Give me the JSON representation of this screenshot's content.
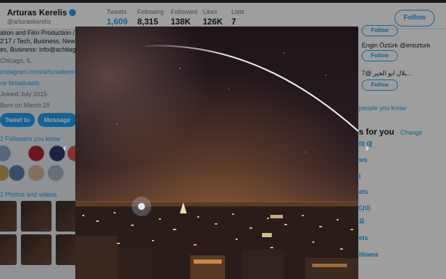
{
  "profile": {
    "name": "Arturas Kerelis",
    "handle": "@arturaskerelis",
    "bio_lines": [
      "ation and Film Production / @OIS",
      "2'17 / Tech, Business, News, Spa",
      "es, Business: info@achitago.org"
    ],
    "location": "Chicago, IL",
    "website": "instagram.com/arturaskerelis",
    "live_link": "ne broadcasts",
    "joined": "Joined July 2015",
    "born": "Born on March 29"
  },
  "stats": [
    {
      "label": "Tweets",
      "value": "1,609"
    },
    {
      "label": "Following",
      "value": "8,315"
    },
    {
      "label": "Followers",
      "value": "138K"
    },
    {
      "label": "Likes",
      "value": "126K"
    },
    {
      "label": "Lists",
      "value": "7"
    }
  ],
  "buttons": {
    "follow": "Follow",
    "tweet_to": "Tweet to",
    "message": "Message"
  },
  "followers_you_know": "2 Followers you know",
  "photos_videos": "2 Photos and videos",
  "who_to_follow": [
    {
      "name": "Engin Öztürk",
      "handle": "@enozturk",
      "follow": "Follow"
    },
    {
      "name": "بلال ابو الخير",
      "handle": "@7...",
      "follow": "Follow"
    }
  ],
  "people_you_know": "people you know",
  "trends": {
    "heading": "s for you",
    "change": "· Change",
    "items": [
      "마 대",
      "ws",
      "I",
      "ets",
      "다이",
      "요",
      "ets",
      "illiams"
    ]
  },
  "colors": {
    "accent": "#1da1f2",
    "night_sky": "#2b1e24",
    "city_glow": "#d98a3a"
  },
  "icons": {
    "verified": "verified-badge-icon",
    "prev": "chevron-left-icon",
    "next": "chevron-right-icon"
  }
}
